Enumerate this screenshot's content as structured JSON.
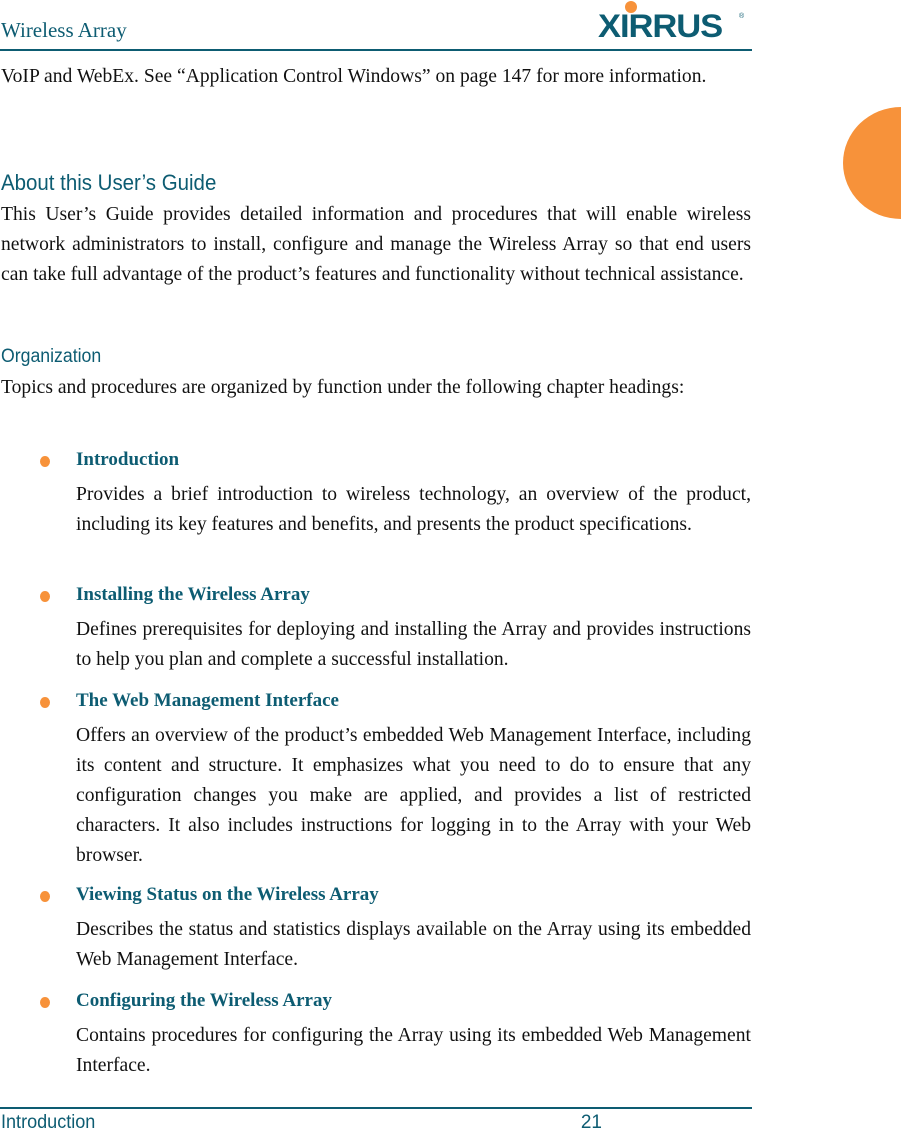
{
  "header": {
    "title": "Wireless Array",
    "logo_text": "XIRRUS",
    "logo_reg": "®"
  },
  "colors": {
    "brand_teal": "#0d5c72",
    "accent_orange": "#f7923a",
    "body_text": "#111111"
  },
  "content": {
    "intro_continuation": "VoIP and WebEx. See “Application Control Windows” on page 147 for more information.",
    "section_heading": "About this User’s Guide",
    "section_paragraph": "This User’s Guide provides detailed information and procedures that will enable wireless network administrators to install, configure and manage the Wireless Array so that end users can take full advantage of the product’s features and functionality without technical assistance.",
    "subsection_heading": "Organization",
    "subsection_paragraph": "Topics and procedures are organized by function under the following chapter headings:",
    "chapters": [
      {
        "title": "Introduction",
        "description": "Provides a brief introduction to wireless technology, an overview of the product, including its key features and benefits, and presents the product specifications."
      },
      {
        "title": "Installing the Wireless Array",
        "description": "Defines prerequisites for deploying and installing the Array and provides instructions to help you plan and complete a successful installation."
      },
      {
        "title": "The Web Management Interface",
        "description": "Offers an overview of the product’s embedded Web Management Interface, including its content and structure. It emphasizes what you need to do to ensure that any configuration changes you make are applied, and provides a list of restricted characters. It also includes instructions for logging in to the Array with your Web browser."
      },
      {
        "title": "Viewing Status on the Wireless Array",
        "description": "Describes the status and statistics displays available on the Array using its embedded Web Management Interface."
      },
      {
        "title": "Configuring the Wireless Array",
        "description": "Contains procedures for configuring the Array using its embedded Web Management Interface."
      }
    ]
  },
  "footer": {
    "chapter_name": "Introduction",
    "page_number": "21"
  }
}
